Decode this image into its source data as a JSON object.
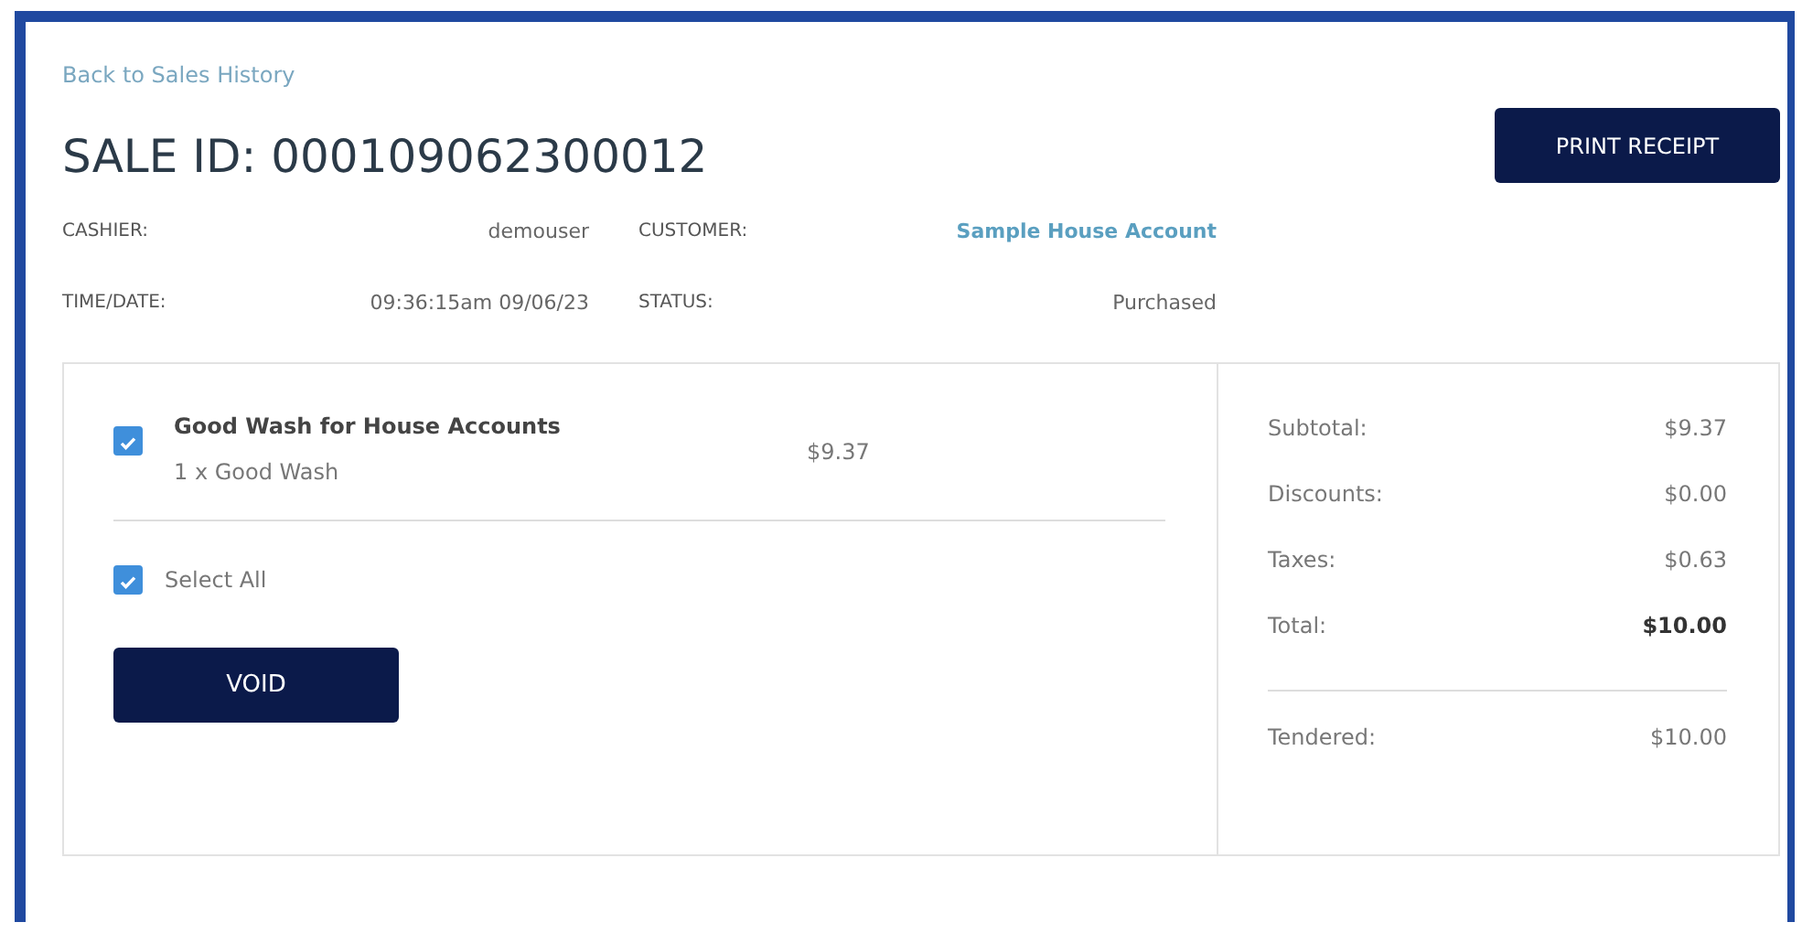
{
  "back_link": "Back to Sales History",
  "title": "SALE ID: 000109062300012",
  "print_button": "PRINT RECEIPT",
  "info": [
    {
      "label": "CASHIER:",
      "value": "demouser",
      "kind": "text"
    },
    {
      "label": "CUSTOMER:",
      "value": "Sample House Account",
      "kind": "link"
    },
    {
      "label": "TIME/DATE:",
      "value": "09:36:15am 09/06/23",
      "kind": "text"
    },
    {
      "label": "STATUS:",
      "value": "Purchased",
      "kind": "text"
    }
  ],
  "items": [
    {
      "name": "Good Wash for House Accounts",
      "detail": "1 x Good Wash",
      "price": "$9.37",
      "checked": true
    }
  ],
  "select_all": {
    "label": "Select All",
    "checked": true
  },
  "void_button": "VOID",
  "summary": [
    {
      "label": "Subtotal:",
      "value": "$9.37",
      "kind": "line"
    },
    {
      "label": "Discounts:",
      "value": "$0.00",
      "kind": "line"
    },
    {
      "label": "Taxes:",
      "value": "$0.63",
      "kind": "line"
    },
    {
      "label": "Total:",
      "value": "$10.00",
      "kind": "total"
    }
  ],
  "tendered": {
    "label": "Tendered:",
    "value": "$10.00"
  }
}
